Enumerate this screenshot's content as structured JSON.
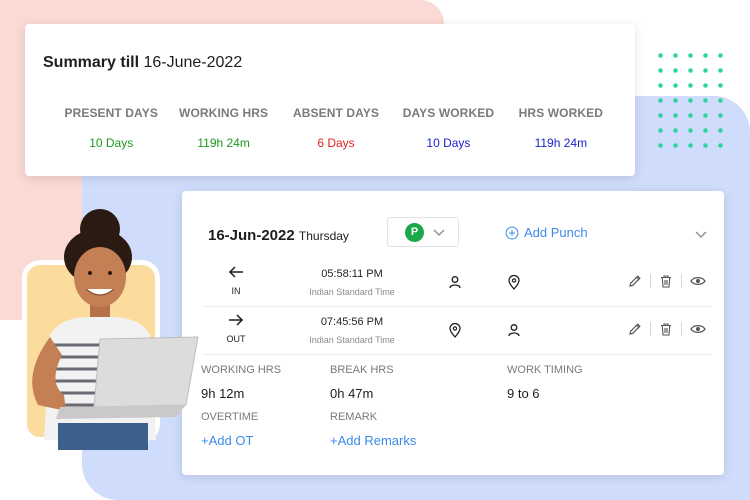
{
  "colors": {
    "pink_bg": "#fbd9d4",
    "blue_bg": "#cfdcfb",
    "yellow_bg": "#fbdc9d",
    "present_green": "#1a9a1a",
    "absent_red": "#e22222",
    "worked_blue": "#1a22c8",
    "link_blue": "#3a8be8",
    "dots_green": "#2dd3a0"
  },
  "summary": {
    "title_bold": "Summary till",
    "title_date": "16-June-2022",
    "stats": [
      {
        "label": "PRESENT DAYS",
        "value": "10 Days"
      },
      {
        "label": "WORKING HRS",
        "value": "119h 24m"
      },
      {
        "label": "ABSENT DAYS",
        "value": "6 Days"
      },
      {
        "label": "DAYS WORKED",
        "value": "10 Days"
      },
      {
        "label": "HRS WORKED",
        "value": "119h 24m"
      }
    ]
  },
  "attendance": {
    "date": "16-Jun-2022",
    "weekday": "Thursday",
    "status": "P",
    "add_punch": "Add Punch",
    "punch_in": {
      "label": "IN",
      "time": "05:58:11 PM",
      "zone": "Indian Standard Time"
    },
    "punch_out": {
      "label": "OUT",
      "time": "07:45:56 PM",
      "zone": "Indian Standard Time"
    },
    "working_hrs_label": "WORKING HRS",
    "working_hrs_value": "9h 12m",
    "break_hrs_label": "BREAK HRS",
    "break_hrs_value": "0h 47m",
    "work_timing_label": "WORK TIMING",
    "work_timing_value": "9 to 6",
    "overtime_label": "OVERTIME",
    "add_ot": "+Add OT",
    "remark_label": "REMARK",
    "add_remarks": "+Add Remarks"
  },
  "icons": [
    "arrow-left-icon",
    "arrow-right-icon",
    "user-icon",
    "location-pin-icon",
    "edit-pencil-icon",
    "trash-icon",
    "eye-icon",
    "chevron-down-icon",
    "plus-circle-icon"
  ]
}
